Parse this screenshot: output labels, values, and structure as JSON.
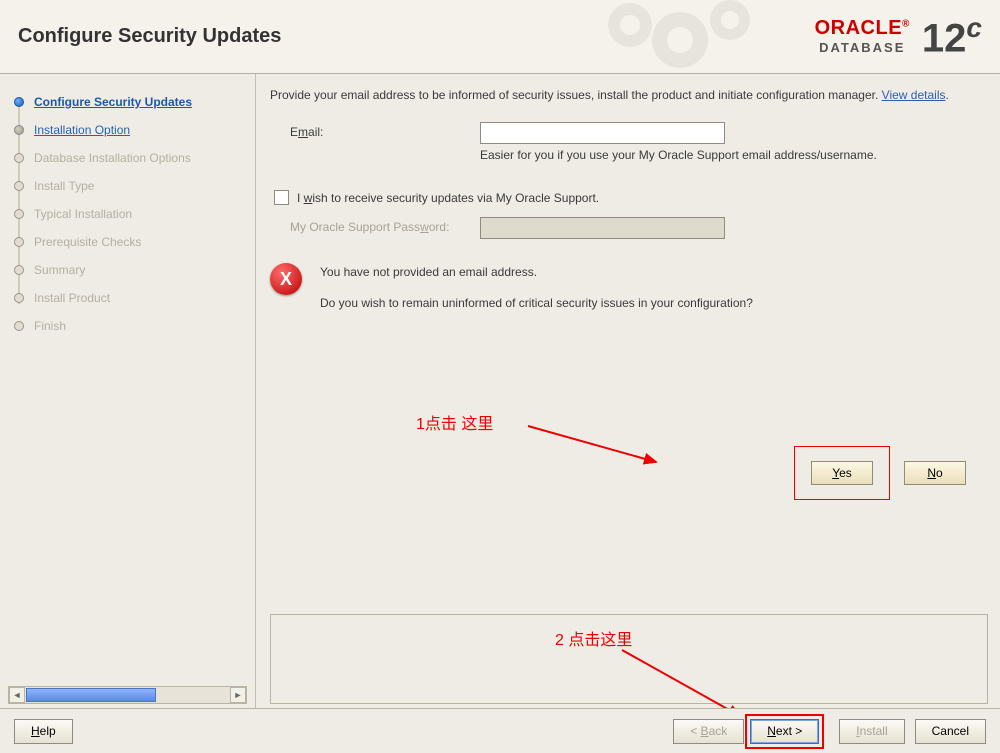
{
  "header": {
    "title": "Configure Security Updates",
    "brand": "ORACLE",
    "brand_sub": "DATABASE",
    "version": "12",
    "version_suffix": "c"
  },
  "sidebar": {
    "steps": [
      {
        "label": "Configure Security Updates",
        "state": "active"
      },
      {
        "label": "Installation Option",
        "state": "link"
      },
      {
        "label": "Database Installation Options",
        "state": "disabled"
      },
      {
        "label": "Install Type",
        "state": "disabled"
      },
      {
        "label": "Typical Installation",
        "state": "disabled"
      },
      {
        "label": "Prerequisite Checks",
        "state": "disabled"
      },
      {
        "label": "Summary",
        "state": "disabled"
      },
      {
        "label": "Install Product",
        "state": "disabled"
      },
      {
        "label": "Finish",
        "state": "disabled"
      }
    ]
  },
  "content": {
    "intro": "Provide your email address to be informed of security issues, install the product and initiate configuration manager. ",
    "view_details": "View details",
    "email_label": "Email:",
    "email_value": "",
    "email_hint": "Easier for you if you use your My Oracle Support email address/username.",
    "checkbox_label_pre": "I ",
    "checkbox_label_u": "w",
    "checkbox_label_post": "ish to receive security updates via My Oracle Support.",
    "password_label": "My Oracle Support Password:",
    "dialog_line1": "You have not provided an email address.",
    "dialog_line2": "Do you wish to remain uninformed of critical security issues in your configuration?",
    "yes_label": "Yes",
    "no_label": "No"
  },
  "annotations": {
    "a1": "1点击 这里",
    "a2": "2 点击这里"
  },
  "footer": {
    "help": "Help",
    "back": "< Back",
    "next": "Next >",
    "install": "Install",
    "cancel": "Cancel"
  }
}
